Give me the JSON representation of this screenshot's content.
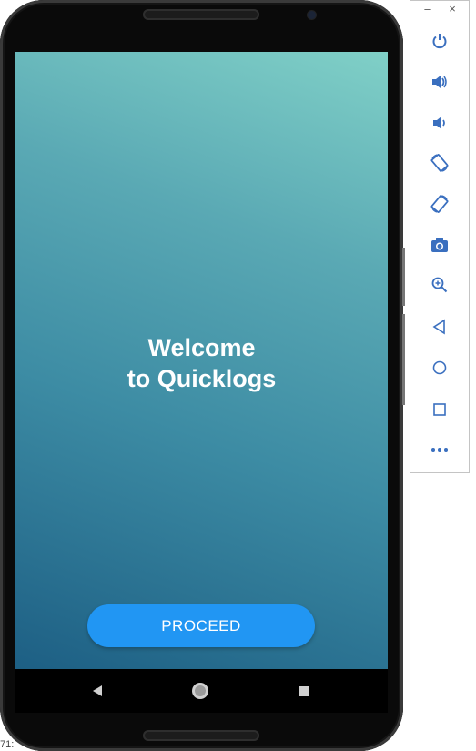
{
  "screen": {
    "welcome_line1": "Welcome",
    "welcome_line2": "to Quicklogs",
    "proceed_label": "PROCEED",
    "gradient_top_color": "#80d0c7",
    "gradient_bottom_color": "#1d5f84",
    "button_color": "#2196f3"
  },
  "navbar": {
    "back_icon": "back-triangle-icon",
    "home_icon": "home-circle-icon",
    "recents_icon": "recents-square-icon"
  },
  "emulator_toolbar": {
    "minimize_label": "–",
    "close_label": "×",
    "tools": [
      "power-icon",
      "volume-up-icon",
      "volume-down-icon",
      "rotate-left-icon",
      "rotate-right-icon",
      "camera-icon",
      "zoom-icon",
      "back-icon",
      "home-icon",
      "overview-icon",
      "more-icon"
    ]
  },
  "corner_text": "71:"
}
